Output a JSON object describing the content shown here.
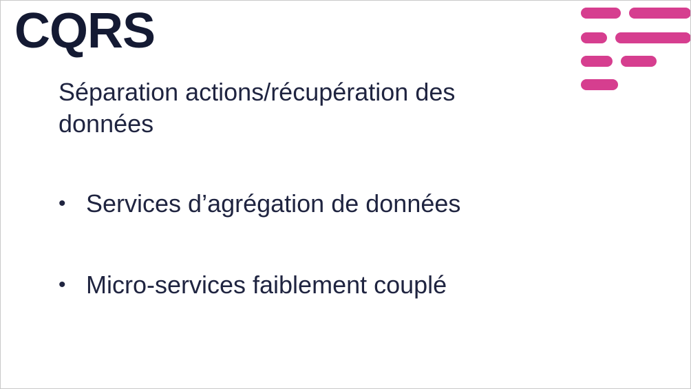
{
  "slide": {
    "title": "CQRS",
    "subtitle": "Séparation actions/récupération des données",
    "bullets": [
      "Services d’agrégation de données",
      "Micro-services faiblement couplé"
    ],
    "bullet_glyph": "•"
  },
  "logo": {
    "icon": "pink-bars-logo-icon",
    "color": "#d63e8f"
  }
}
